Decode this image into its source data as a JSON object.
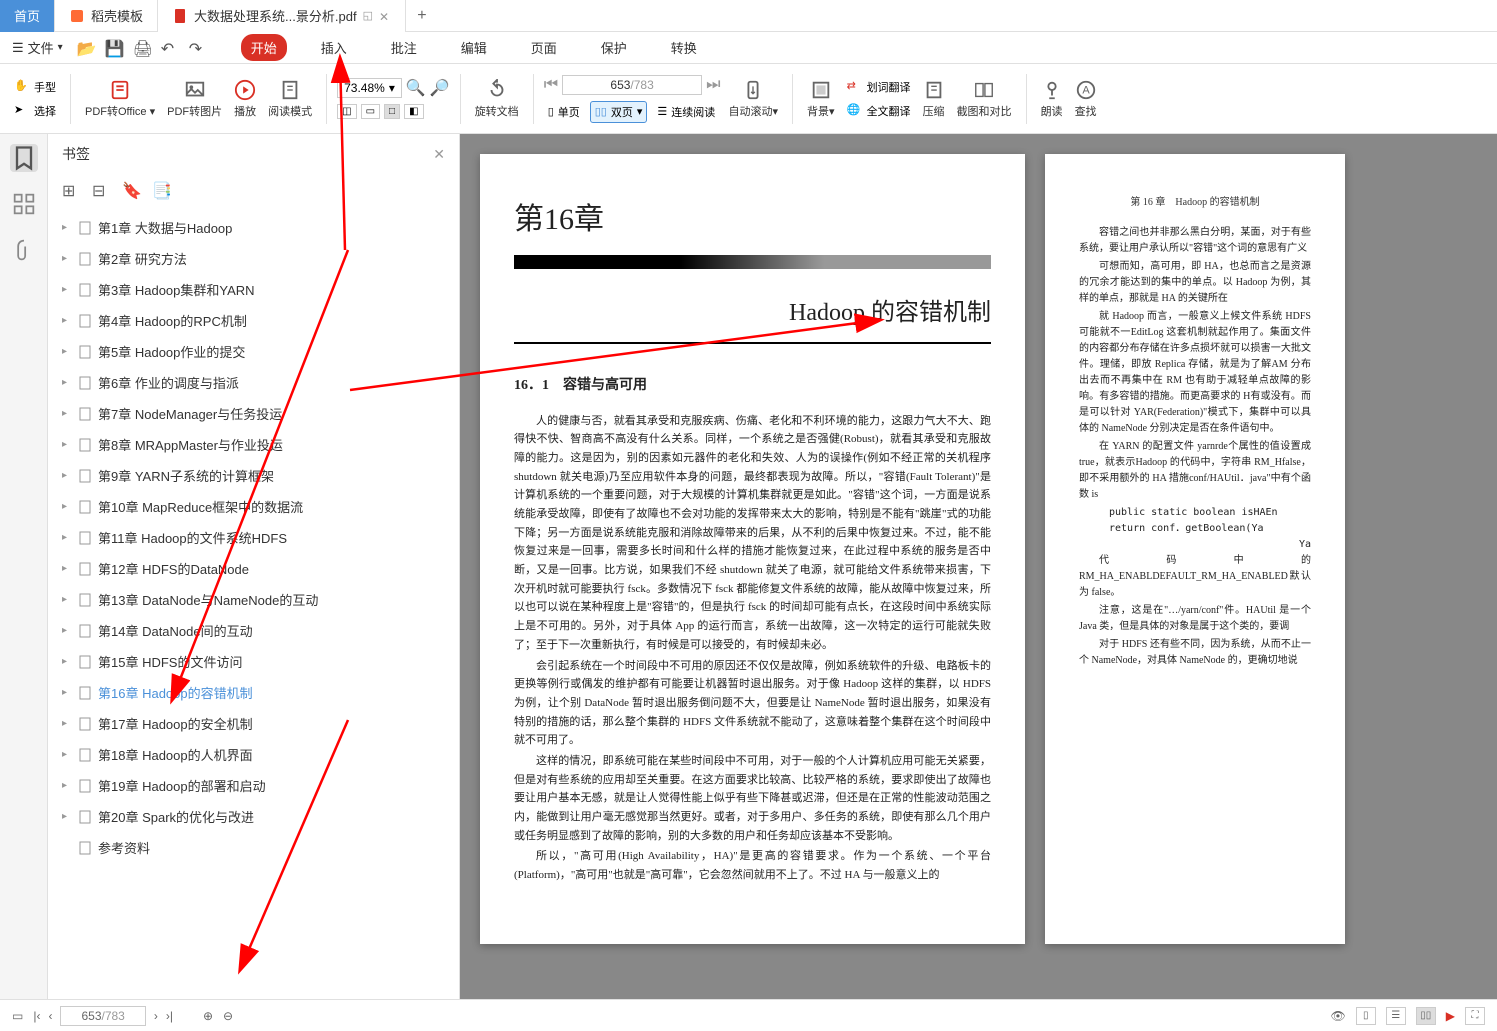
{
  "tabs": {
    "home": "首页",
    "template": "稻壳模板",
    "doc": "大数据处理系统...景分析.pdf"
  },
  "menu": {
    "file": "文件",
    "items": [
      "开始",
      "插入",
      "批注",
      "编辑",
      "页面",
      "保护",
      "转换"
    ]
  },
  "ribbon": {
    "hand": "手型",
    "select": "选择",
    "pdf_office": "PDF转Office",
    "pdf_image": "PDF转图片",
    "play": "播放",
    "read_mode": "阅读模式",
    "zoom": "73.48%",
    "rotate": "旋转文档",
    "single": "单页",
    "double": "双页",
    "continuous": "连续阅读",
    "auto_scroll": "自动滚动",
    "background": "背景",
    "word_translate": "划词翻译",
    "full_translate": "全文翻译",
    "compress": "压缩",
    "screenshot": "截图和对比",
    "read_aloud": "朗读",
    "find": "查找",
    "page_current": "653",
    "page_total": "/783"
  },
  "bookmarks": {
    "title": "书签",
    "items": [
      "第1章 大数据与Hadoop",
      "第2章 研究方法",
      "第3章 Hadoop集群和YARN",
      "第4章 Hadoop的RPC机制",
      "第5章 Hadoop作业的提交",
      "第6章 作业的调度与指派",
      "第7章 NodeManager与任务投运",
      "第8章 MRAppMaster与作业投运",
      "第9章 YARN子系统的计算框架",
      "第10章 MapReduce框架中的数据流",
      "第11章 Hadoop的文件系统HDFS",
      "第12章 HDFS的DataNode",
      "第13章 DataNode与NameNode的互动",
      "第14章 DataNode间的互动",
      "第15章 HDFS的文件访问",
      "第16章 Hadoop的容错机制",
      "第17章 Hadoop的安全机制",
      "第18章 Hadoop的人机界面",
      "第19章 Hadoop的部署和启动",
      "第20章 Spark的优化与改进",
      "参考资料"
    ],
    "active_index": 15
  },
  "document": {
    "chapter_num": "第16章",
    "chapter_title": "Hadoop 的容错机制",
    "section_title": "16．1　容错与高可用",
    "para1": "人的健康与否，就看其承受和克服疾病、伤痛、老化和不利环境的能力，这跟力气大不大、跑得快不快、智商高不高没有什么关系。同样，一个系统之是否强健(Robust)，就看其承受和克服故障的能力。这是因为，别的因素如元器件的老化和失效、人为的误操作(例如不经正常的关机程序 shutdown 就关电源)乃至应用软件本身的问题，最终都表现为故障。所以，\"容错(Fault Tolerant)\"是计算机系统的一个重要问题，对于大规模的计算机集群就更是如此。\"容错\"这个词，一方面是说系统能承受故障，即使有了故障也不会对功能的发挥带来太大的影响，特别是不能有\"跳崖\"式的功能下降；另一方面是说系统能克服和消除故障带来的后果，从不利的后果中恢复过来。不过，能不能恢复过来是一回事，需要多长时间和什么样的措施才能恢复过来，在此过程中系统的服务是否中断，又是一回事。比方说，如果我们不经 shutdown 就关了电源，就可能给文件系统带来损害，下次开机时就可能要执行 fsck。多数情况下 fsck 都能修复文件系统的故障，能从故障中恢复过来，所以也可以说在某种程度上是\"容错\"的，但是执行 fsck 的时间却可能有点长，在这段时间中系统实际上是不可用的。另外，对于具体 App 的运行而言，系统一出故障，这一次特定的运行可能就失败了；至于下一次重新执行，有时候是可以接受的，有时候却未必。",
    "para2": "会引起系统在一个时间段中不可用的原因还不仅仅是故障，例如系统软件的升级、电路板卡的更换等例行或偶发的维护都有可能要让机器暂时退出服务。对于像 Hadoop 这样的集群，以 HDFS 为例，让个别 DataNode 暂时退出服务倒问题不大，但要是让 NameNode 暂时退出服务，如果没有特别的措施的话，那么整个集群的 HDFS 文件系统就不能动了，这意味着整个集群在这个时间段中就不可用了。",
    "para3": "这样的情况，即系统可能在某些时间段中不可用，对于一般的个人计算机应用可能无关紧要，但是对有些系统的应用却至关重要。在这方面要求比较高、比较严格的系统，要求即使出了故障也要让用户基本无感，就是让人觉得性能上似乎有些下降甚或迟滞，但还是在正常的性能波动范围之内，能做到让用户毫无感觉那当然更好。或者，对于多用户、多任务的系统，即使有那么几个用户或任务明显感到了故障的影响，别的大多数的用户和任务却应该基本不受影响。",
    "para4": "所以，\"高可用(High Availability，HA)\"是更高的容错要求。作为一个系统、一个平台(Platform)，\"高可用\"也就是\"高可靠\"，它会忽然间就用不上了。不过 HA 与一般意义上的",
    "right_header": "第 16 章　Hadoop 的容错机制",
    "right_para1": "容错之间也并非那么黑白分明，某面，对于有些系统，要让用户承认所以\"容错\"这个词的意思有广义",
    "right_para2": "可想而知，高可用，即 HA，也总而言之是资源的冗余才能达到的集中的单点。以 Hadoop 为例，其样的单点，那就是 HA 的关键所在",
    "right_para3": "就 Hadoop 而言，一般意义上候文件系统 HDFS 可能就不一EditLog 这套机制就起作用了。集面文件的内容都分布存储在许多点损坏就可以损害一大批文件。理储，即放 Replica 存储，就是为了解AM 分布出去而不再集中在 RM 也有助于减轻单点故障的影响。有多容错的措施。而更高要求的 H有或没有。而是可以针对 YAR(Federation)\"模式下，集群中可以具体的 NameNode 分别决定是否在条件语句中。",
    "right_para4": "在 YARN 的配置文件 yarnrde个属性的值设置成 true，就表示Hadoop 的代码中，字符串 RM_Hfalse，即不采用额外的 HA 措施conf/HAUtil．java\"中有个函数 is",
    "right_code1": "public static boolean isHAEn",
    "right_code2": "return conf．getBoolean(Ya",
    "right_code3": "Ya",
    "right_para5": "代码中的 RM_HA_ENABLDEFAULT_RM_HA_ENABLED默认为 false。",
    "right_para6": "注意，这是在\"…/yarn/conf\"件。HAUtil 是一个 Java 类，但是具体的对象是属于这个类的，要调",
    "right_para7": "对于 HDFS 还有些不同，因为系统，从而不止一个 NameNode，对具体 NameNode 的，更确切地说"
  },
  "status": {
    "page_current": "653",
    "page_total": "/783"
  }
}
